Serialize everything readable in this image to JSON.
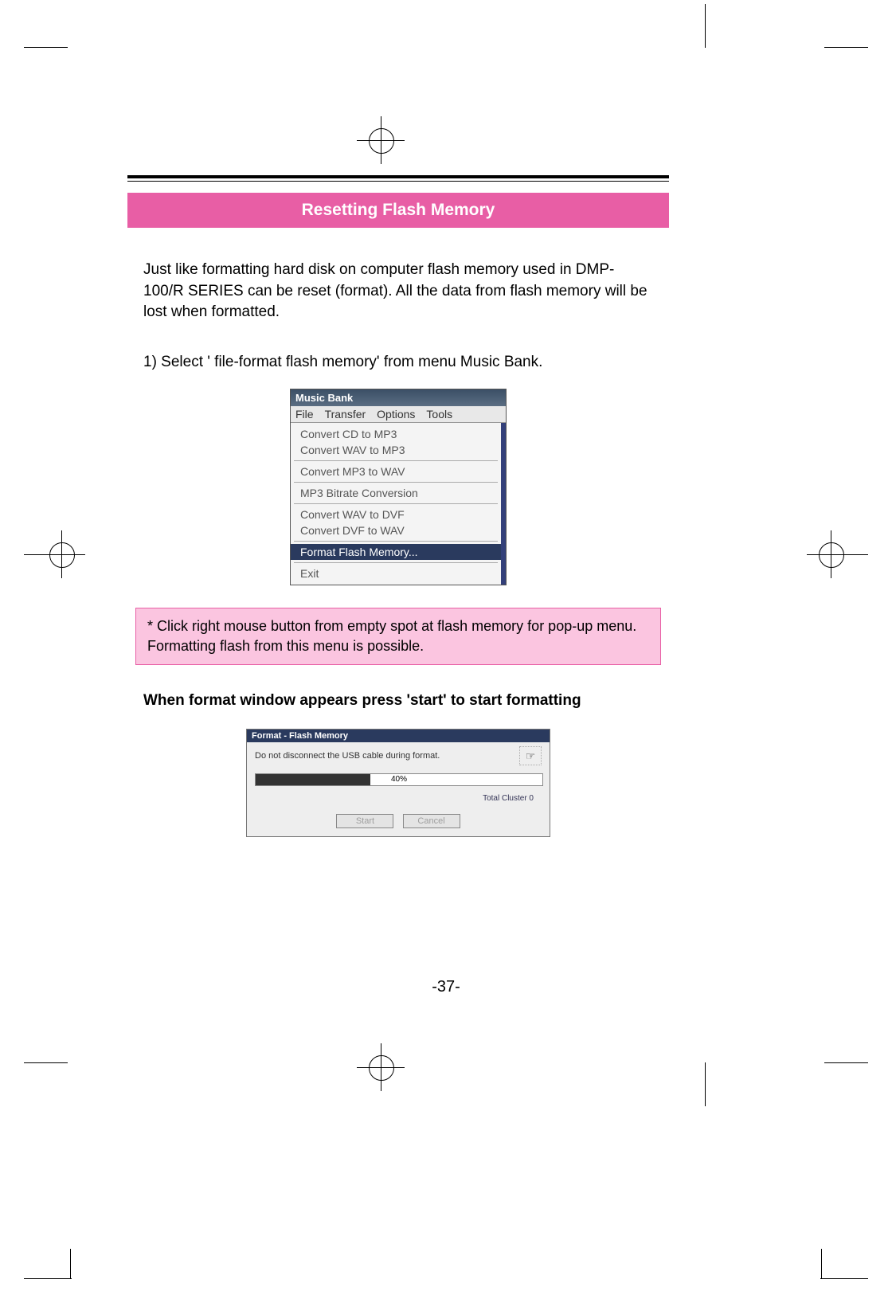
{
  "header": {
    "title": "Resetting Flash Memory"
  },
  "intro": "Just like formatting hard disk on computer flash memory used in DMP-100/R SERIES can be reset (format). All the data from flash memory will be lost when formatted.",
  "step1": "1) Select ' file-format flash memory' from menu Music Bank.",
  "menu_screenshot": {
    "window_title": "Music Bank",
    "menubar": {
      "file": "File",
      "transfer": "Transfer",
      "options": "Options",
      "tools": "Tools"
    },
    "items": {
      "convert_cd": "Convert CD to MP3",
      "convert_wav_mp3": "Convert WAV to MP3",
      "convert_mp3_wav": "Convert MP3 to WAV",
      "mp3_bitrate": "MP3 Bitrate Conversion",
      "convert_wav_dvf": "Convert WAV to DVF",
      "convert_dvf_wav": "Convert DVF to WAV",
      "format_flash": "Format Flash Memory...",
      "exit": "Exit"
    }
  },
  "note": "* Click right mouse button from empty spot at flash memory for pop-up menu. Formatting flash from this menu is possible.",
  "step2_bold": "When format window appears press 'start' to start formatting",
  "format_dialog": {
    "title": "Format - Flash Memory",
    "warning": "Do not disconnect the USB cable during format.",
    "percent": "40%",
    "cluster": "Total Cluster   0",
    "start": "Start",
    "cancel": "Cancel"
  },
  "page_number": "-37-"
}
